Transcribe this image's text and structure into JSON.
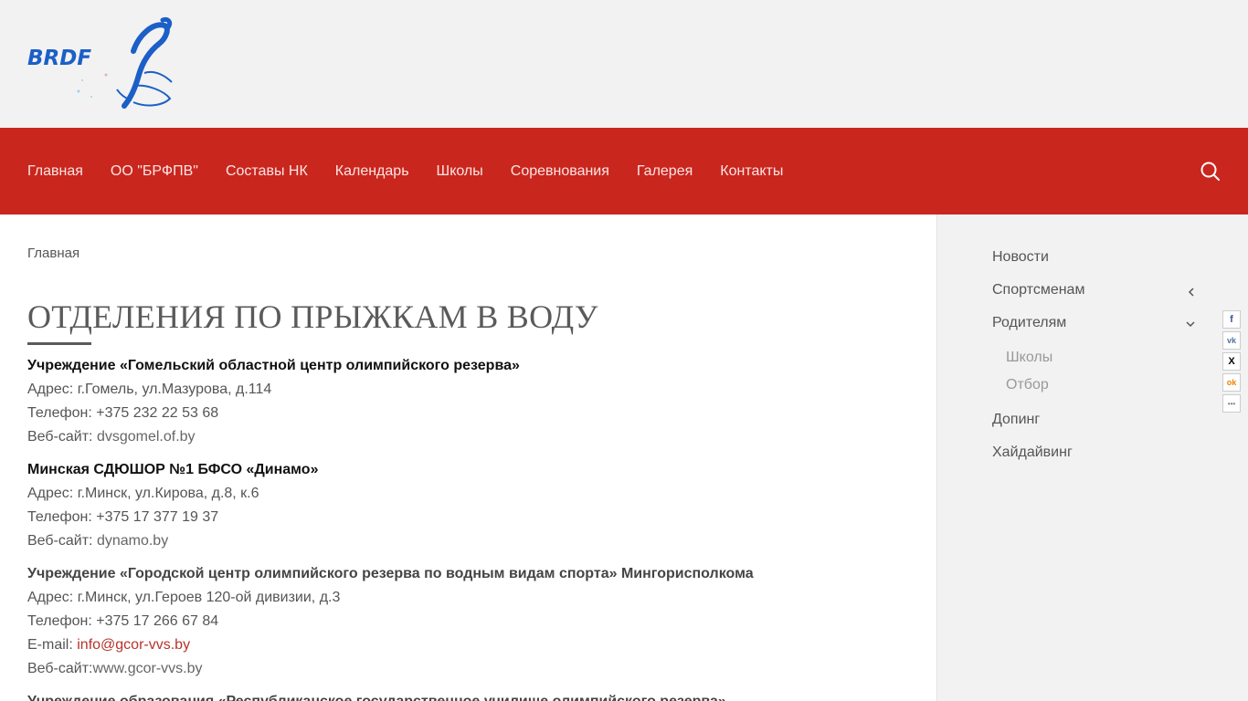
{
  "header": {
    "logo_text": "BRDF"
  },
  "nav": {
    "items": [
      "Главная",
      "ОО \"БРФПВ\"",
      "Составы НК",
      "Календарь",
      "Школы",
      "Соревнования",
      "Галерея",
      "Контакты"
    ]
  },
  "main": {
    "breadcrumb": "Главная",
    "title": "ОТДЕЛЕНИЯ ПО ПРЫЖКАМ В ВОДУ",
    "orgs": [
      {
        "name": "Учреждение «Гомельский областной центр олимпийского резерва»",
        "address": "Адрес: г.Гомель, ул.Мазурова, д.114",
        "phone": "Телефон: +375 232 22 53 68",
        "web_label": "Веб-сайт: ",
        "web": "dvsgomel.of.by"
      },
      {
        "name": "Минская СДЮШОР №1 БФСО «Динамо»",
        "address": "Адрес: г.Минск, ул.Кирова, д.8, к.6",
        "phone": "Телефон: +375 17 377 19 37",
        "web_label": "Веб-сайт: ",
        "web": "dynamo.by"
      },
      {
        "name": "Учреждение «Городской центр олимпийского резерва по водным видам спорта» Мингорисполкома",
        "address": "Адрес: г.Минск, ул.Героев 120-ой дивизии, д.3",
        "phone": "Телефон: +375 17 266 67 84",
        "email_label": "E-mail: ",
        "email": "info@gcor-vvs.by",
        "web_label": "Веб-сайт:",
        "web": "www.gcor-vvs.by"
      },
      {
        "name": "Учреждение образования «Республиканское государственное училище олимпийского резерва»"
      }
    ]
  },
  "sidebar": {
    "items": [
      "Новости",
      "Спортсменам",
      "Родителям",
      "Допинг",
      "Хайдайвинг"
    ],
    "subitems": [
      "Школы",
      "Отбор"
    ]
  },
  "share": {
    "icons": [
      "facebook-icon",
      "vk-icon",
      "x-icon",
      "ok-icon",
      "more-icon"
    ],
    "labels": [
      "f",
      "vk",
      "X",
      "ok",
      "•••"
    ],
    "colors": [
      "#3b5998",
      "#4c75a3",
      "#000000",
      "#ee8208",
      "#888888"
    ]
  },
  "colors": {
    "nav_bg": "#c9261e",
    "header_bg": "#f2f2f2",
    "logo_blue": "#1b5fc7",
    "link_red": "#b8322a"
  }
}
